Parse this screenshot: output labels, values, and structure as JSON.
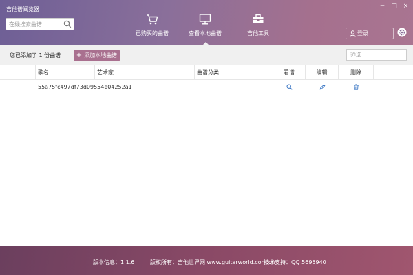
{
  "window": {
    "title": "吉他谱阅览器",
    "controls": {
      "minimize": "−",
      "maximize": "□",
      "close": "×"
    }
  },
  "search": {
    "placeholder": "在线搜索曲谱",
    "icon": "search-icon"
  },
  "nav": {
    "tabs": [
      {
        "label": "已购买的曲谱",
        "icon": "cart-icon",
        "active": false
      },
      {
        "label": "查看本地曲谱",
        "icon": "monitor-icon",
        "active": true
      },
      {
        "label": "吉他工具",
        "icon": "toolbox-icon",
        "active": false
      }
    ]
  },
  "login": {
    "label": "登录",
    "icon": "user-icon"
  },
  "settings": {
    "icon": "gear-icon"
  },
  "toolbar": {
    "added_text": "您已添加了 1 份曲谱",
    "add_local_label": "添加本地曲谱",
    "filter_placeholder": "筛选"
  },
  "table": {
    "headers": [
      "",
      "歌名",
      "艺术家",
      "曲谱分类",
      "看谱",
      "编辑",
      "删除",
      ""
    ],
    "rows": [
      {
        "name": "55a75fc497df73d09554e04252a1",
        "artist": "",
        "category": ""
      }
    ]
  },
  "footer": {
    "version": "版本信息：1.1.6",
    "copyright": "版权所有：吉他世界网 www.guitarworld.com.cn",
    "support": "技术支持：QQ 5695940"
  },
  "colors": {
    "header_start": "#6e5f96",
    "header_end": "#a97591",
    "accent": "#a9708f",
    "icon_blue": "#3a76c4",
    "footer_start": "#6b3f5e",
    "footer_end": "#a0566f"
  }
}
